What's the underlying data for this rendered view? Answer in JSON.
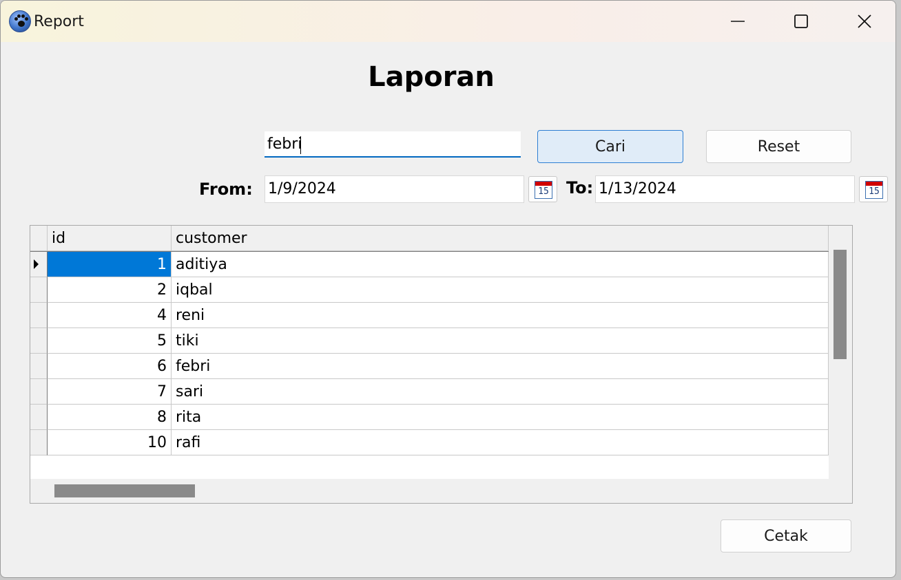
{
  "window": {
    "title": "Report",
    "app_icon": "paw-icon"
  },
  "heading": "Laporan",
  "search": {
    "value": "febri"
  },
  "buttons": {
    "cari": "Cari",
    "reset": "Reset",
    "cetak": "Cetak"
  },
  "filters": {
    "from_label": "From:",
    "from_value": "1/9/2024",
    "to_label": "To:",
    "to_value": "1/13/2024",
    "calendar_icon_text": "15"
  },
  "table": {
    "columns": [
      "id",
      "customer"
    ],
    "rows": [
      {
        "id": "1",
        "customer": "aditiya"
      },
      {
        "id": "2",
        "customer": "iqbal"
      },
      {
        "id": "4",
        "customer": "reni"
      },
      {
        "id": "5",
        "customer": "tiki"
      },
      {
        "id": "6",
        "customer": "febri"
      },
      {
        "id": "7",
        "customer": "sari"
      },
      {
        "id": "8",
        "customer": "rita"
      },
      {
        "id": "10",
        "customer": "rafi"
      }
    ],
    "selected_row": 0
  },
  "colors": {
    "accent": "#0078d7",
    "focus_border": "#0067c0",
    "calendar_red": "#d00000"
  }
}
